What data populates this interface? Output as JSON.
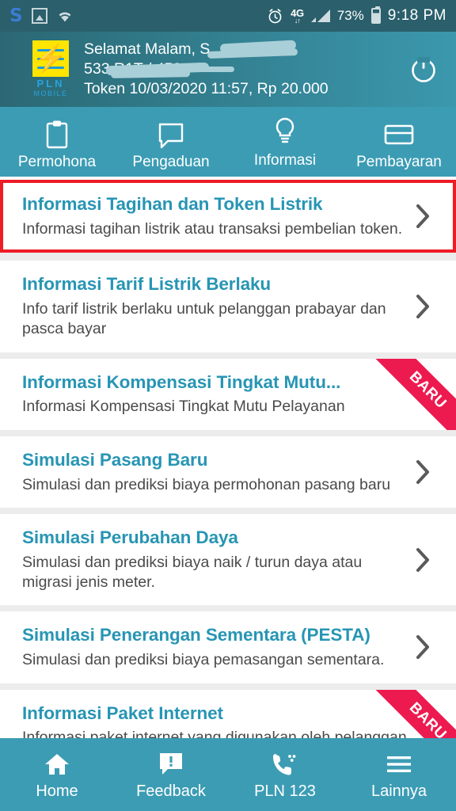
{
  "status_bar": {
    "left_icons": [
      "s-logo-icon",
      "screenshot-icon",
      "wifi-icon"
    ],
    "alarm_icon": "alarm-clock-icon",
    "network_label": "4G",
    "network_arrows": "↓↑",
    "battery_percent": "73%",
    "battery_icon": "battery-icon",
    "clock": "9:18 PM"
  },
  "header": {
    "logo_text": "PLN",
    "logo_sub": "MOBILE",
    "greeting": "Selamat Malam, S",
    "account_line": "533                    R1T / 450",
    "token_line": "Token 10/03/2020 11:57, Rp 20.000",
    "power_icon": "power-button-icon"
  },
  "tabs": [
    {
      "label": "Permohona",
      "icon": "clipboard-icon",
      "active": false
    },
    {
      "label": "Pengaduan",
      "icon": "chat-bubble-icon",
      "active": false
    },
    {
      "label": "Informasi",
      "icon": "lightbulb-icon",
      "active": true
    },
    {
      "label": "Pembayaran",
      "icon": "credit-card-icon",
      "active": false
    }
  ],
  "list": [
    {
      "title": "Informasi Tagihan dan Token Listrik",
      "desc": "Informasi tagihan listrik atau transaksi pembelian token.",
      "badge": "",
      "highlighted": true
    },
    {
      "title": "Informasi Tarif Listrik Berlaku",
      "desc": "Info tarif listrik berlaku untuk pelanggan prabayar dan pasca bayar",
      "badge": "",
      "highlighted": false
    },
    {
      "title": "Informasi Kompensasi Tingkat Mutu...",
      "desc": "Informasi Kompensasi Tingkat Mutu Pelayanan",
      "badge": "BARU",
      "highlighted": false
    },
    {
      "title": "Simulasi Pasang Baru",
      "desc": "Simulasi dan prediksi biaya permohonan pasang baru",
      "badge": "",
      "highlighted": false
    },
    {
      "title": "Simulasi Perubahan Daya",
      "desc": "Simulasi dan prediksi biaya naik / turun daya atau migrasi jenis meter.",
      "badge": "",
      "highlighted": false
    },
    {
      "title": "Simulasi Penerangan Sementara (PESTA)",
      "desc": "Simulasi dan prediksi biaya pemasangan sementara.",
      "badge": "",
      "highlighted": false
    },
    {
      "title": "Informasi Paket Internet",
      "desc": "Informasi paket internet yang digunakan oleh pelanggan.",
      "badge": "BARU",
      "highlighted": false
    }
  ],
  "bottom_nav": [
    {
      "label": "Home",
      "icon": "home-icon"
    },
    {
      "label": "Feedback",
      "icon": "feedback-bubble-icon"
    },
    {
      "label": "PLN 123",
      "icon": "phone-call-icon"
    },
    {
      "label": "Lainnya",
      "icon": "hamburger-menu-icon"
    }
  ],
  "colors": {
    "header_dark": "#2b6874",
    "header_light": "#3b98ad",
    "teal": "#3c9cb4",
    "title_blue": "#2795b4",
    "highlight_red": "#ee1c25",
    "badge_pink": "#ed1a4f",
    "list_bg": "#ececec"
  }
}
